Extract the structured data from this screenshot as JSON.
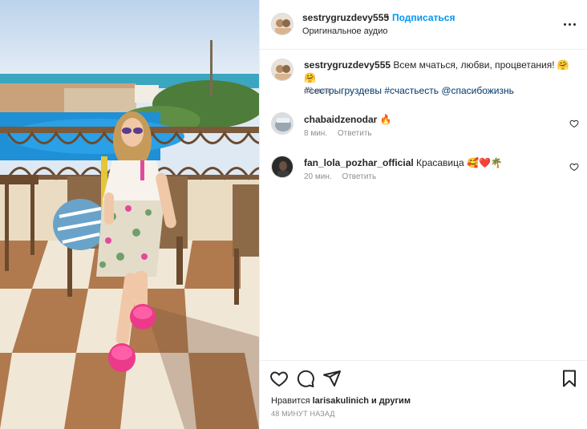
{
  "header": {
    "username": "sestrygruzdevy555",
    "separator": "•",
    "follow_label": "Подписаться",
    "audio": "Оригинальное аудио",
    "more_icon": "more-horizontal-icon"
  },
  "caption": {
    "username": "sestrygruzdevy555",
    "text": "Всем мчаться, любви, процветания!",
    "emojis": "🤗🤗",
    "hashtag1": "#сестрыгруздевы",
    "hashtag2": "#счастьесть",
    "mention": "@спасибожизнь",
    "time": "48 мин."
  },
  "comments": [
    {
      "username": "chabaidzenodar",
      "text": "🔥",
      "time": "8 мин.",
      "reply_label": "Ответить"
    },
    {
      "username": "fan_lola_pozhar_official",
      "text": "Красавица 🥰❤️🌴",
      "time": "20 мин.",
      "reply_label": "Ответить"
    }
  ],
  "actions": {
    "like_icon": "heart-icon",
    "comment_icon": "comment-icon",
    "share_icon": "send-icon",
    "save_icon": "bookmark-icon"
  },
  "likes": {
    "prefix": "Нравится",
    "user": "larisakulinich",
    "suffix": "и другим"
  },
  "post_time": "48 МИНУТ НАЗАД",
  "colors": {
    "link_blue": "#0095f6",
    "hashtag": "#00376b",
    "secondary_text": "#8e8e8e",
    "divider": "#efefef"
  }
}
